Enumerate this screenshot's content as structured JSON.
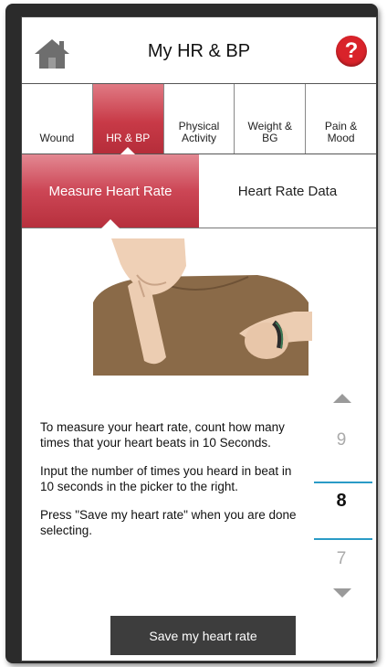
{
  "header": {
    "title": "My HR & BP",
    "home_icon": "home-icon",
    "help_icon": "help-icon",
    "help_symbol": "?"
  },
  "tabs": [
    {
      "label": "Wound",
      "active": false
    },
    {
      "label": "HR & BP",
      "active": true
    },
    {
      "label": "Physical\nActivity",
      "active": false
    },
    {
      "label": "Weight &\nBG",
      "active": false
    },
    {
      "label": "Pain &\nMood",
      "active": false
    }
  ],
  "subtabs": [
    {
      "label": "Measure Heart Rate",
      "active": true
    },
    {
      "label": "Heart Rate Data",
      "active": false
    }
  ],
  "instructions": [
    "To measure your heart rate, count how many times that your heart beats in 10 Seconds.",
    "Input the number of times you heard in beat in 10 seconds in the picker to the right.",
    "Press \"Save my heart rate\" when you are done selecting."
  ],
  "picker": {
    "previous": "9",
    "selected": "8",
    "next": "7"
  },
  "save_button": "Save my heart rate",
  "colors": {
    "accent": "#c83a47",
    "picker_line": "#2a9bc6",
    "button": "#3d3d3d"
  }
}
